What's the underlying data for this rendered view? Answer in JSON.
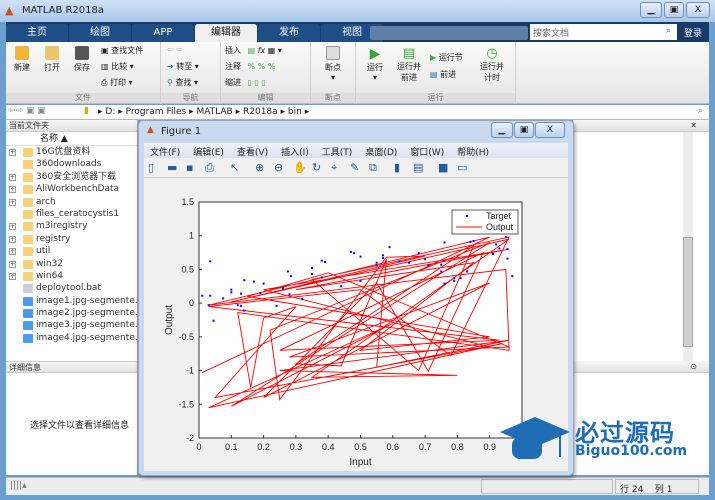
{
  "window": {
    "title": "MATLAB R2018a",
    "minimize": "▁",
    "maximize": "▣",
    "close": "X"
  },
  "tabs": [
    {
      "label": "主页"
    },
    {
      "label": "绘图"
    },
    {
      "label": "APP"
    },
    {
      "label": "编辑器",
      "active": true
    },
    {
      "label": "发布"
    },
    {
      "label": "视图"
    }
  ],
  "search": {
    "placeholder": "搜索文档"
  },
  "login": "登录",
  "ribbon": {
    "file": {
      "label": "文件",
      "new": "新建",
      "open": "打开",
      "save": "保存",
      "find_files": "查找文件",
      "compare": "比较",
      "print": "打印"
    },
    "nav": {
      "label": "导航",
      "goto": "转至",
      "find": "查找"
    },
    "edit": {
      "label": "编辑",
      "insert": "插入",
      "comment": "注释",
      "indent": "缩进",
      "fx": "fx"
    },
    "breakpoints": {
      "label": "断点",
      "bp": "断点"
    },
    "run": {
      "label": "运行",
      "run": "运行",
      "run_advance": "运行并\n前进",
      "run_section": "运行节",
      "advance": "前进",
      "run_time": "运行并\n计时"
    }
  },
  "address": {
    "path": [
      "D:",
      "Program Files",
      "MATLAB",
      "R2018a",
      "bin"
    ]
  },
  "current_folder": {
    "title": "当前文件夹",
    "col_name": "名称 ▲",
    "items": [
      {
        "name": "16G优盘资料",
        "type": "folder",
        "expandable": true
      },
      {
        "name": "360downloads",
        "type": "folder",
        "expandable": false
      },
      {
        "name": "360安全浏览器下载",
        "type": "folder",
        "expandable": true
      },
      {
        "name": "AliWorkbenchData",
        "type": "folder",
        "expandable": true
      },
      {
        "name": "arch",
        "type": "folder",
        "expandable": true
      },
      {
        "name": "files_ceratocystis1",
        "type": "folder",
        "expandable": false
      },
      {
        "name": "m3iregistry",
        "type": "folder",
        "expandable": true
      },
      {
        "name": "registry",
        "type": "folder",
        "expandable": true
      },
      {
        "name": "util",
        "type": "folder",
        "expandable": true
      },
      {
        "name": "win32",
        "type": "folder",
        "expandable": true
      },
      {
        "name": "win64",
        "type": "folder",
        "expandable": true
      },
      {
        "name": "deploytool.bat",
        "type": "bat",
        "expandable": false
      },
      {
        "name": "image1.jpg-segmente...",
        "type": "image",
        "expandable": false
      },
      {
        "name": "image2.jpg-segmente...",
        "type": "image",
        "expandable": false
      },
      {
        "name": "image3.jpg-segmente...",
        "type": "image",
        "expandable": false
      },
      {
        "name": "image4.jpg-segmente...",
        "type": "image",
        "expandable": false
      }
    ]
  },
  "details": {
    "title": "详细信息",
    "message": "选择文件以查看详细信息"
  },
  "status": {
    "row_label": "行",
    "row": "24",
    "col_label": "列",
    "col": "1"
  },
  "figure": {
    "title": "Figure 1",
    "menu": [
      "文件(F)",
      "编辑(E)",
      "查看(V)",
      "插入(I)",
      "工具(T)",
      "桌面(D)",
      "窗口(W)",
      "帮助(H)"
    ],
    "toolbar": [
      "new-icon",
      "open-icon",
      "save-icon",
      "print-icon",
      "pointer-icon",
      "zoom-in-icon",
      "zoom-out-icon",
      "pan-icon",
      "rotate-icon",
      "data-cursor-icon",
      "brush-icon",
      "link-icon",
      "colorbar-icon",
      "legend-icon",
      "hide-tools-icon",
      "show-tools-icon"
    ]
  },
  "watermark": {
    "text": "必过源码",
    "url_text": "Biguo100.com"
  },
  "chart_data": {
    "type": "scatter",
    "xlabel": "Input",
    "ylabel": "Output",
    "xlim": [
      0,
      1
    ],
    "ylim": [
      -2,
      1.5
    ],
    "xticks": [
      "0",
      "0.1",
      "0.2",
      "0.3",
      "0.4",
      "0.5",
      "0.6",
      "0.7",
      "0.8",
      "0.9"
    ],
    "yticks": [
      "-2",
      "-1.5",
      "-1",
      "-0.5",
      "0",
      "0.5",
      "1",
      "1.5"
    ],
    "legend": {
      "position": "top-right",
      "entries": [
        "Target",
        "Output"
      ]
    },
    "colors": {
      "Target": "#0000ff",
      "Output": "#ff0000"
    },
    "series": [
      {
        "name": "Target",
        "type": "scatter",
        "points": [
          [
            0.01,
            0.11
          ],
          [
            0.03,
            -0.03
          ],
          [
            0.035,
            0.62
          ],
          [
            0.035,
            0.11
          ],
          [
            0.045,
            -0.26
          ],
          [
            0.075,
            0.07
          ],
          [
            0.1,
            0.2
          ],
          [
            0.1,
            0.16
          ],
          [
            0.12,
            -0.03
          ],
          [
            0.13,
            -0.04
          ],
          [
            0.13,
            0.14
          ],
          [
            0.14,
            -0.11
          ],
          [
            0.14,
            0.34
          ],
          [
            0.17,
            0.32
          ],
          [
            0.19,
            0.15
          ],
          [
            0.2,
            0.29
          ],
          [
            0.24,
            -0.04
          ],
          [
            0.26,
            0.22
          ],
          [
            0.275,
            0.47
          ],
          [
            0.28,
            0.13
          ],
          [
            0.285,
            0.4
          ],
          [
            0.32,
            0.06
          ],
          [
            0.35,
            0.43
          ],
          [
            0.35,
            0.52
          ],
          [
            0.38,
            0.63
          ],
          [
            0.39,
            0.61
          ],
          [
            0.38,
            0.38
          ],
          [
            0.44,
            0.25
          ],
          [
            0.47,
            0.76
          ],
          [
            0.48,
            0.74
          ],
          [
            0.5,
            0.69
          ],
          [
            0.5,
            0.33
          ],
          [
            0.55,
            0.6
          ],
          [
            0.55,
            0.56
          ],
          [
            0.57,
            0.71
          ],
          [
            0.57,
            0.67
          ],
          [
            0.59,
            0.83
          ],
          [
            0.62,
            0.62
          ],
          [
            0.65,
            0.6
          ],
          [
            0.68,
            0.74
          ],
          [
            0.7,
            0.65
          ],
          [
            0.71,
            0.56
          ],
          [
            0.75,
            0.57
          ],
          [
            0.76,
            0.9
          ],
          [
            0.76,
            0.29
          ],
          [
            0.75,
            0.47
          ],
          [
            0.79,
            0.37
          ],
          [
            0.79,
            0.33
          ],
          [
            0.81,
            0.37
          ],
          [
            0.83,
            0.47
          ],
          [
            0.84,
            0.91
          ],
          [
            0.85,
            0.92
          ],
          [
            0.91,
            0.73
          ],
          [
            0.92,
            0.87
          ],
          [
            0.93,
            0.81
          ],
          [
            0.95,
            0.98
          ],
          [
            0.955,
            0.8
          ],
          [
            0.955,
            0.66
          ],
          [
            0.97,
            0.4
          ]
        ]
      },
      {
        "name": "Output",
        "type": "line",
        "points": [
          [
            0.01,
            -1.03
          ],
          [
            0.9,
            0.98
          ],
          [
            0.03,
            -0.03
          ],
          [
            0.95,
            0.5
          ],
          [
            0.96,
            -0.7
          ],
          [
            0.12,
            -0.14
          ],
          [
            0.16,
            -1.25
          ],
          [
            0.2,
            -0.22
          ],
          [
            0.3,
            -0.05
          ],
          [
            0.05,
            -1.4
          ],
          [
            0.94,
            -0.6
          ],
          [
            0.03,
            -1.55
          ],
          [
            0.6,
            -0.3
          ],
          [
            0.1,
            -1.53
          ],
          [
            0.9,
            0.9
          ],
          [
            0.22,
            -0.4
          ],
          [
            0.25,
            -1.43
          ],
          [
            0.58,
            0.68
          ],
          [
            0.7,
            0.7
          ],
          [
            0.1,
            0.02
          ],
          [
            0.96,
            0.95
          ],
          [
            0.35,
            -1.1
          ],
          [
            0.8,
            -1.07
          ],
          [
            0.25,
            -1.0
          ],
          [
            0.96,
            -0.55
          ],
          [
            0.55,
            -0.95
          ],
          [
            0.58,
            0.65
          ],
          [
            0.44,
            -0.93
          ],
          [
            0.3,
            -0.9
          ],
          [
            0.85,
            0.85
          ],
          [
            0.68,
            -1.0
          ],
          [
            0.35,
            0.35
          ],
          [
            0.96,
            0.98
          ],
          [
            0.78,
            -0.78
          ],
          [
            0.5,
            0.2
          ],
          [
            0.03,
            -0.05
          ],
          [
            0.93,
            -0.55
          ],
          [
            0.25,
            -0.7
          ],
          [
            0.88,
            0.75
          ],
          [
            0.71,
            -1.01
          ],
          [
            0.55,
            0.3
          ],
          [
            0.2,
            -1.4
          ],
          [
            0.9,
            0.3
          ],
          [
            0.28,
            -0.8
          ],
          [
            0.96,
            -0.65
          ],
          [
            0.4,
            0.45
          ],
          [
            0.15,
            0.1
          ],
          [
            0.9,
            -0.5
          ],
          [
            0.5,
            -0.7
          ],
          [
            0.85,
            0.6
          ],
          [
            0.3,
            0.2
          ],
          [
            0.96,
            0.8
          ],
          [
            0.2,
            0.2
          ],
          [
            0.9,
            -0.65
          ]
        ]
      }
    ]
  }
}
